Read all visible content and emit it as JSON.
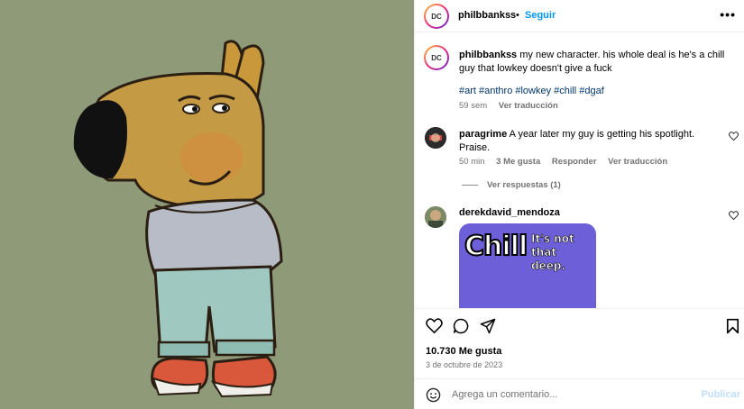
{
  "post": {
    "username": "philbbankss",
    "separator": "•",
    "follow_label": "Seguir",
    "more_label": "•••",
    "avatar_text": "DC"
  },
  "caption": {
    "username": "philbbankss",
    "text": " my new character. his whole deal is he's a chill guy that lowkey doesn't give a fuck",
    "hashtags": "#art #anthro #lowkey #chill #dgaf",
    "time": "59 sem",
    "translate": "Ver traducción"
  },
  "comments": [
    {
      "username": "paragrime",
      "text": " A year later my guy is getting his spotlight. Praise.",
      "time": "50 min",
      "likes": "3 Me gusta",
      "reply": "Responder",
      "translate": "Ver traducción",
      "view_replies": "Ver respuestas (1)"
    },
    {
      "username": "derekdavid_mendoza",
      "sticker_big": "Chill",
      "sticker_small": "It's not that deep."
    }
  ],
  "stats": {
    "likes": "10.730 Me gusta",
    "date": "3 de octubre de 2023"
  },
  "composer": {
    "placeholder": "Agrega un comentario...",
    "post_label": "Publicar"
  },
  "colors": {
    "accent": "#0095f6",
    "hashtag": "#00376b",
    "muted": "#737373",
    "media_bg": "#8f9a78",
    "sticker_bg": "#6d5fd8"
  }
}
